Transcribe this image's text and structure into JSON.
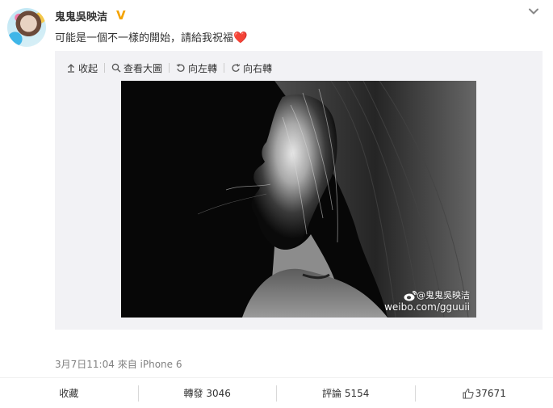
{
  "post": {
    "username": "鬼鬼吳映洁",
    "verified_mark": "V",
    "text": "可能是一個不一樣的開始，請給我祝福",
    "emoji": "❤️"
  },
  "toolbar": {
    "collapse": "收起",
    "view_large": "查看大圖",
    "rotate_left": "向左轉",
    "rotate_right": "向右轉"
  },
  "photo": {
    "watermark_user": "@鬼鬼吳映洁",
    "watermark_site": "weibo.com/gguuii"
  },
  "meta": {
    "timestamp": "3月7日11:04",
    "source_prefix": "來自",
    "source": "iPhone 6"
  },
  "actions": {
    "favorite": "收藏",
    "repost_label": "轉發",
    "repost_count": "3046",
    "comment_label": "評論",
    "comment_count": "5154",
    "like_count": "37671"
  }
}
